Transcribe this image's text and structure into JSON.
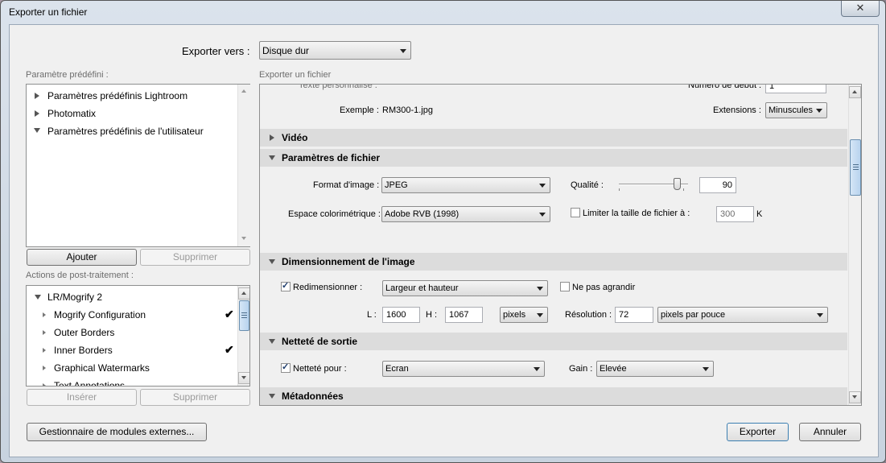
{
  "window": {
    "title": "Exporter un fichier",
    "close_glyph": "✕"
  },
  "top": {
    "export_to_label": "Exporter vers :",
    "export_to_value": "Disque dur"
  },
  "presets": {
    "label": "Paramètre prédéfini :",
    "items": [
      {
        "label": "Paramètres prédéfinis Lightroom",
        "expanded": false
      },
      {
        "label": "Photomatix",
        "expanded": false
      },
      {
        "label": "Paramètres prédéfinis de l'utilisateur",
        "expanded": true
      }
    ],
    "add_button": "Ajouter",
    "remove_button": "Supprimer"
  },
  "post": {
    "label": "Actions de post-traitement :",
    "root": "LR/Mogrify 2",
    "items": [
      {
        "label": "Mogrify Configuration",
        "checked": true
      },
      {
        "label": "Outer Borders",
        "checked": false
      },
      {
        "label": "Inner Borders",
        "checked": true
      },
      {
        "label": "Graphical Watermarks",
        "checked": false
      },
      {
        "label": "Text Annotations",
        "checked": false
      }
    ],
    "insert_button": "Insérer",
    "remove_button": "Supprimer"
  },
  "main": {
    "label": "Exporter un fichier",
    "partial_custom_text": "Texte personnalisé :",
    "partial_start_number": "Numéro de début :",
    "start_number_value": "1",
    "example_label": "Exemple :",
    "example_value": "RM300-1.jpg",
    "extensions_label": "Extensions :",
    "extensions_value": "Minuscules",
    "sections": {
      "video": "Vidéo",
      "file_settings": "Paramètres de fichier",
      "sizing": "Dimensionnement de l'image",
      "sharpening": "Netteté de sortie",
      "metadata": "Métadonnées"
    },
    "file": {
      "format_label": "Format d'image :",
      "format_value": "JPEG",
      "quality_label": "Qualité :",
      "quality_value": "90",
      "quality_fraction": 0.9,
      "colorspace_label": "Espace colorimétrique :",
      "colorspace_value": "Adobe RVB (1998)",
      "limit_label": "Limiter la taille de fichier à :",
      "limit_value": "300",
      "limit_unit": "K"
    },
    "sizing": {
      "resize_label": "Redimensionner :",
      "resize_value": "Largeur et hauteur",
      "no_enlarge_label": "Ne pas agrandir",
      "w_label": "L :",
      "w_value": "1600",
      "h_label": "H :",
      "h_value": "1067",
      "unit_value": "pixels",
      "resolution_label": "Résolution :",
      "resolution_value": "72",
      "resolution_unit": "pixels par pouce"
    },
    "sharpen": {
      "label": "Netteté pour :",
      "value": "Ecran",
      "gain_label": "Gain :",
      "gain_value": "Elevée"
    }
  },
  "footer": {
    "plugins_button": "Gestionnaire de modules externes...",
    "export_button": "Exporter",
    "cancel_button": "Annuler"
  }
}
